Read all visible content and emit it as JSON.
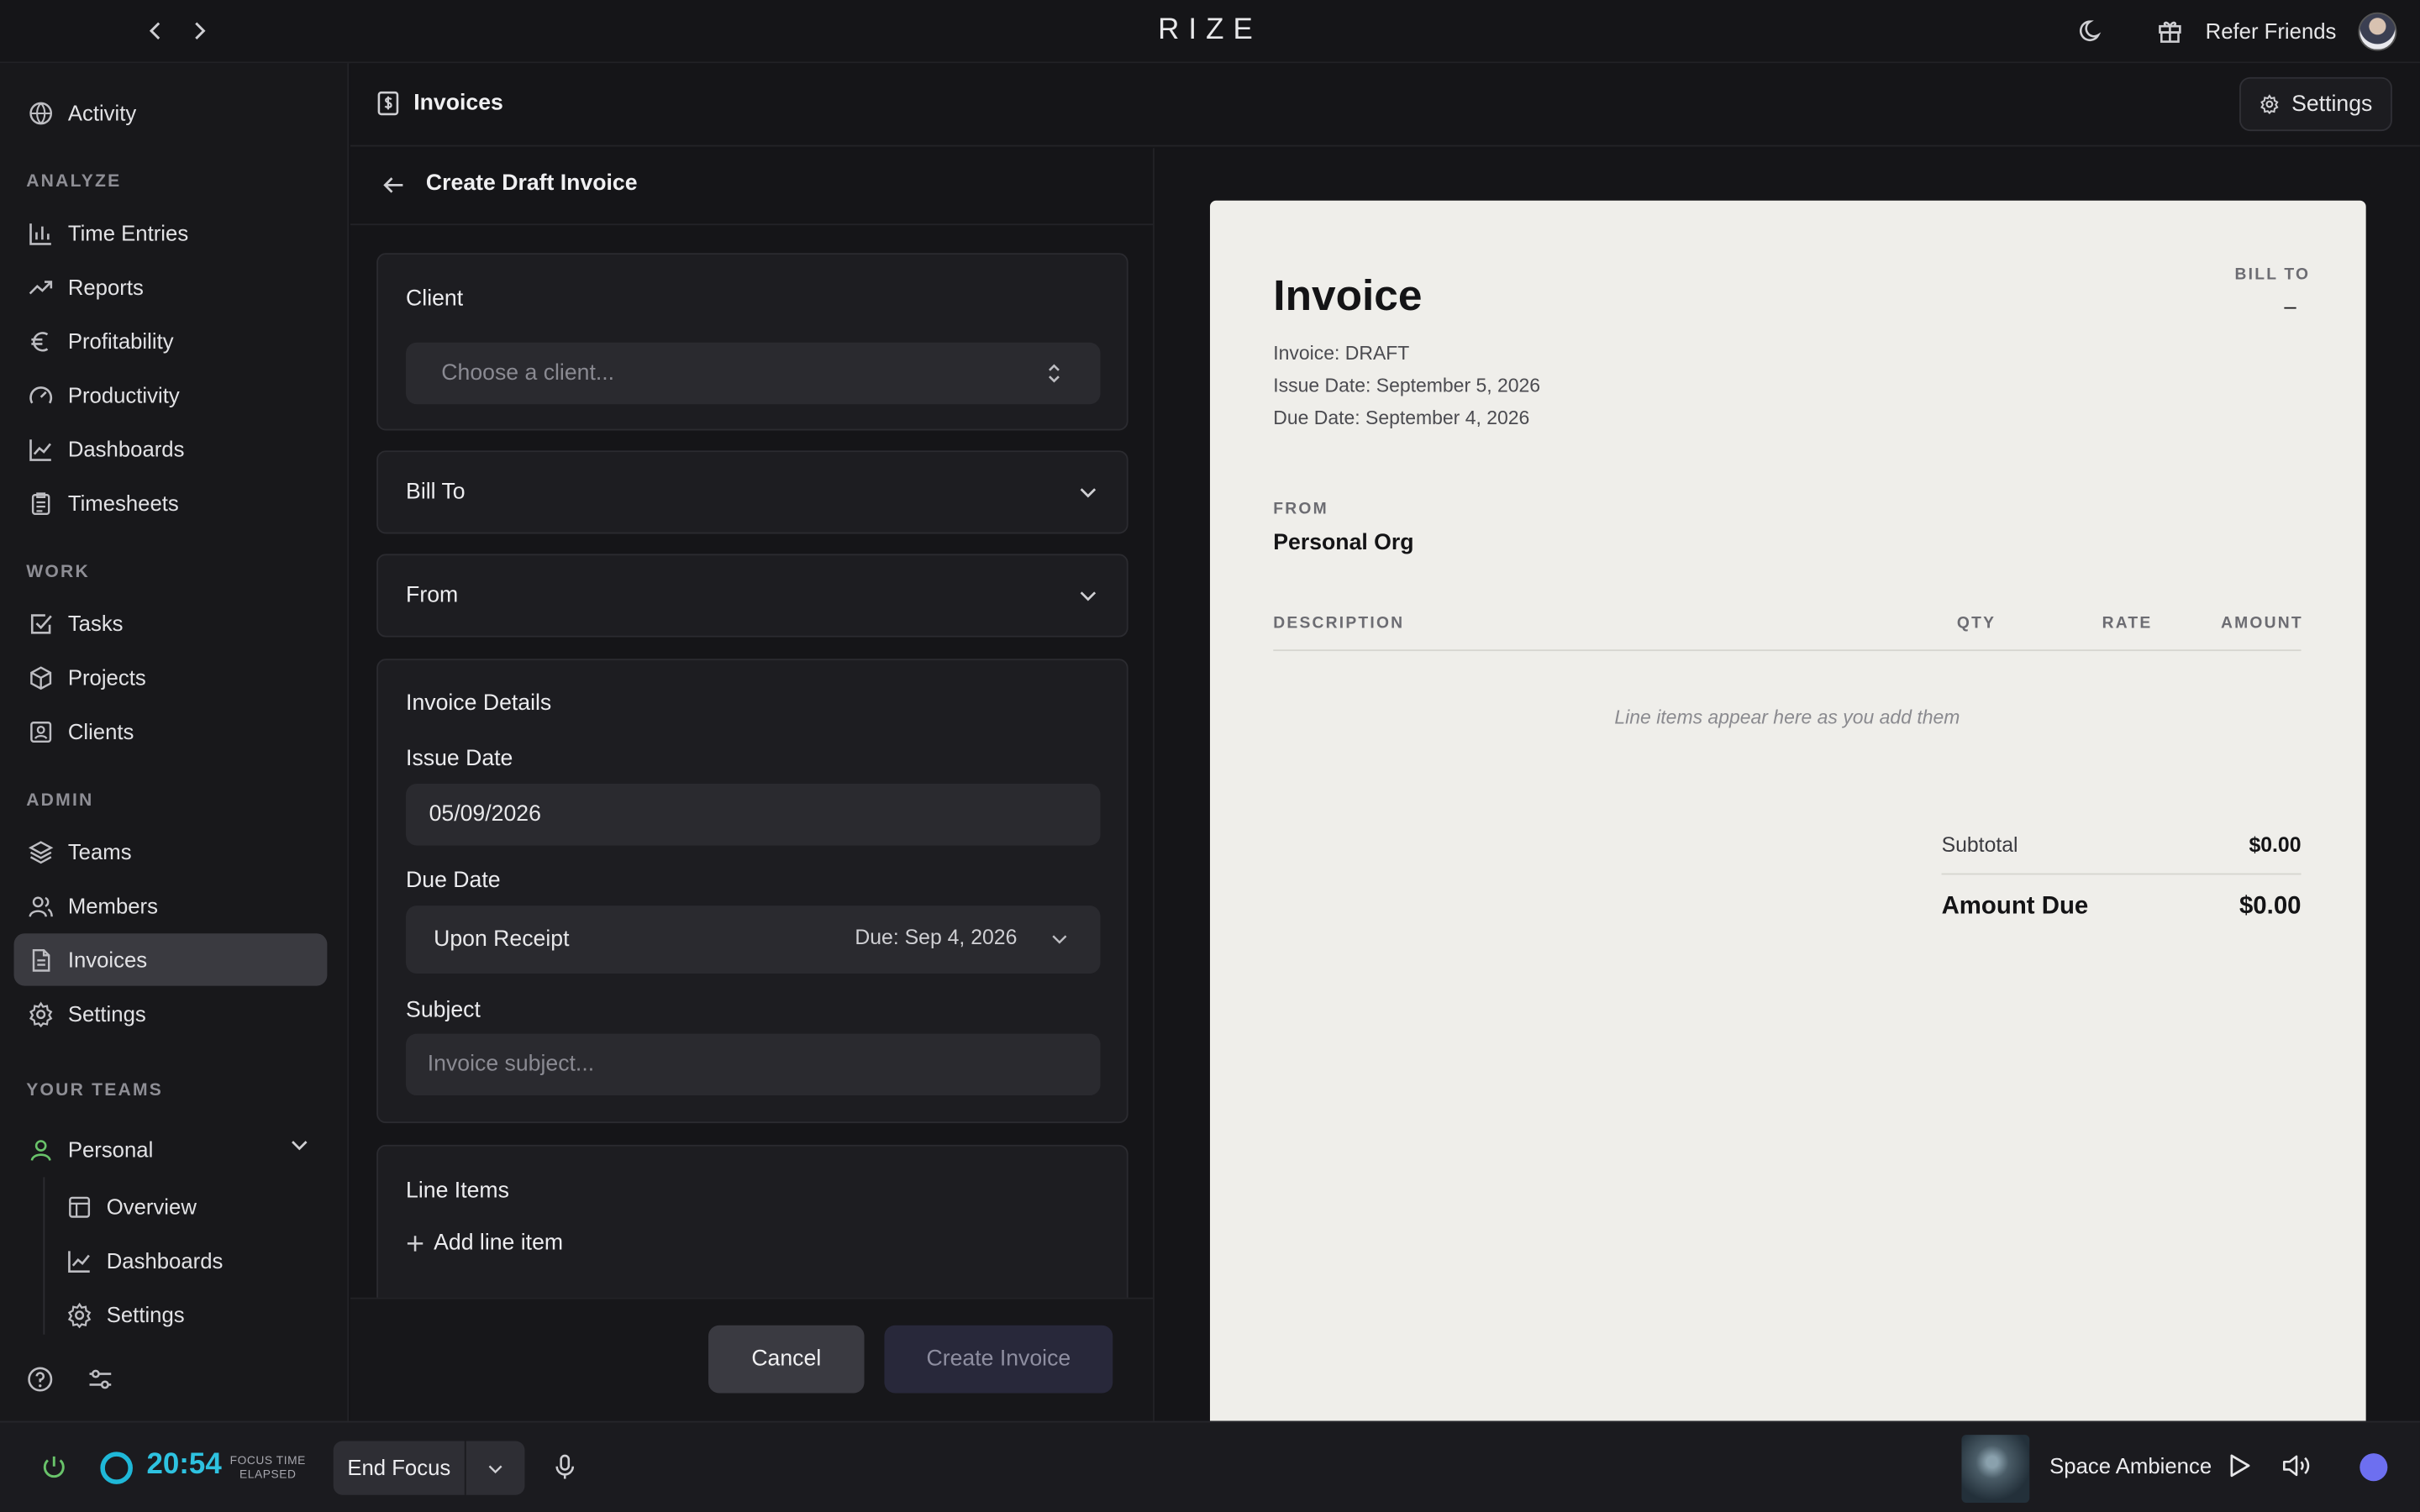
{
  "app": {
    "brand": "RIZE"
  },
  "topbar": {
    "refer_label": "Refer Friends"
  },
  "sidebar": {
    "activity": "Activity",
    "sections": {
      "analyze": "ANALYZE",
      "work": "WORK",
      "admin": "ADMIN",
      "your_teams": "YOUR TEAMS"
    },
    "analyze_items": [
      "Time Entries",
      "Reports",
      "Profitability",
      "Productivity",
      "Dashboards",
      "Timesheets"
    ],
    "work_items": [
      "Tasks",
      "Projects",
      "Clients"
    ],
    "admin_items": [
      "Teams",
      "Members",
      "Invoices",
      "Settings"
    ],
    "team": {
      "name": "Personal",
      "items": [
        "Overview",
        "Dashboards",
        "Settings"
      ]
    },
    "active_item": "Invoices"
  },
  "header": {
    "title": "Invoices",
    "settings_label": "Settings"
  },
  "form": {
    "title": "Create Draft Invoice",
    "client": {
      "label": "Client",
      "placeholder": "Choose a client..."
    },
    "bill_to": {
      "label": "Bill To"
    },
    "from": {
      "label": "From"
    },
    "details": {
      "label": "Invoice Details",
      "issue_date_label": "Issue Date",
      "issue_date_value": "05/09/2026",
      "due_date_label": "Due Date",
      "due_term": "Upon Receipt",
      "due_hint": "Due: Sep 4, 2026",
      "subject_label": "Subject",
      "subject_placeholder": "Invoice subject..."
    },
    "line_items": {
      "label": "Line Items",
      "add_label": "Add line item"
    },
    "cancel_label": "Cancel",
    "create_label": "Create Invoice"
  },
  "preview": {
    "title": "Invoice",
    "invoice_number": "Invoice: DRAFT",
    "issue_date": "Issue Date: September 5, 2026",
    "due_date": "Due Date: September 4, 2026",
    "bill_to_label": "BILL TO",
    "bill_to_value": "–",
    "from_label": "FROM",
    "from_value": "Personal Org",
    "columns": [
      "DESCRIPTION",
      "QTY",
      "RATE",
      "AMOUNT"
    ],
    "empty_note": "Line items appear here as you add them",
    "subtotal_label": "Subtotal",
    "subtotal_value": "$0.00",
    "amount_due_label": "Amount Due",
    "amount_due_value": "$0.00"
  },
  "bottombar": {
    "timer": "20:54",
    "timer_caption_1": "FOCUS TIME",
    "timer_caption_2": "ELAPSED",
    "end_focus_label": "End Focus",
    "music_title": "Space Ambience"
  },
  "colors": {
    "accent_cyan": "#2ec2e0",
    "power_green": "#69c36a",
    "status_dot": "#6d6ff0",
    "paper": "#efeeea"
  }
}
